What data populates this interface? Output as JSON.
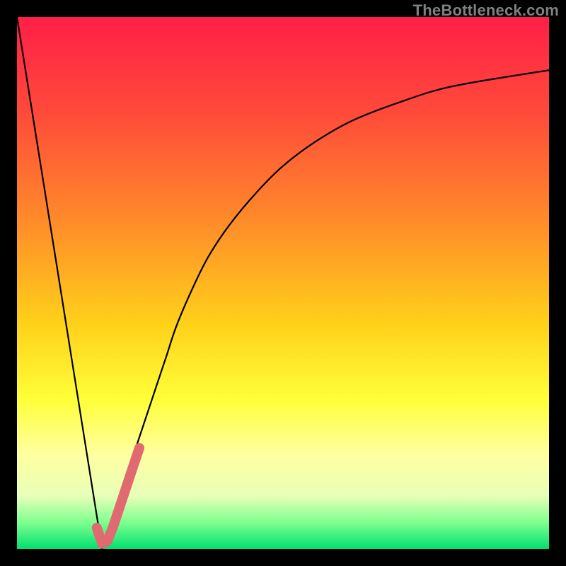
{
  "watermark": "TheBottleneck.com",
  "chart_data": {
    "type": "line",
    "title": "",
    "xlabel": "",
    "ylabel": "",
    "xlim": [
      0,
      100
    ],
    "ylim": [
      0,
      100
    ],
    "series": [
      {
        "name": "left-line",
        "x": [
          0,
          16
        ],
        "values": [
          100,
          0
        ]
      },
      {
        "name": "right-curve",
        "x": [
          16,
          18,
          20,
          22,
          24,
          26,
          28,
          30,
          33,
          36,
          40,
          45,
          50,
          56,
          63,
          72,
          82,
          100
        ],
        "values": [
          0,
          6,
          12,
          18,
          24,
          30,
          36,
          42,
          49,
          55,
          61,
          67,
          72,
          76.5,
          80.5,
          84,
          87,
          90
        ]
      },
      {
        "name": "highlight",
        "x": [
          15,
          16,
          17,
          18,
          19,
          20,
          21,
          22,
          23
        ],
        "values": [
          4,
          1,
          1.5,
          4,
          7,
          10,
          13,
          16,
          19
        ]
      }
    ],
    "colors": {
      "curve": "#000000",
      "highlight": "#e06a6f"
    }
  }
}
